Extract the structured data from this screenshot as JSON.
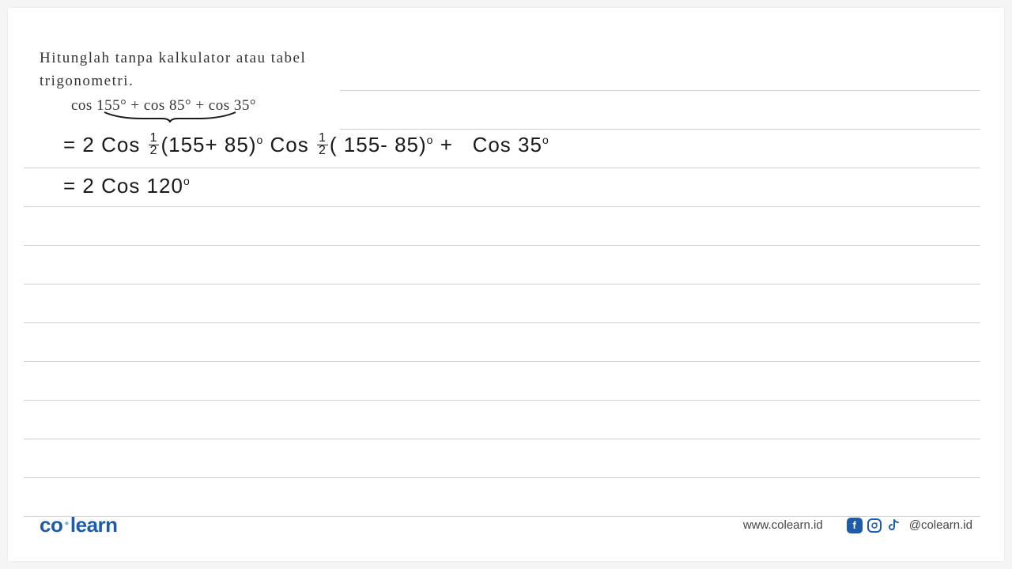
{
  "problem": {
    "line1": "Hitunglah tanpa kalkulator atau tabel",
    "line2": "trigonometri.",
    "formula": "cos 155° + cos 85° + cos 35°"
  },
  "handwriting": {
    "step1_prefix": "= 2 Cos",
    "step1_frac1_num": "1",
    "step1_frac1_den": "2",
    "step1_paren1": "(155+ 85)",
    "step1_mid": " Cos",
    "step1_frac2_num": "1",
    "step1_frac2_den": "2",
    "step1_paren2": "( 155- 85)",
    "step1_plus": " + ",
    "step1_end": "Cos 35",
    "step2": "= 2 Cos 120"
  },
  "footer": {
    "logo_co": "co",
    "logo_learn": "learn",
    "website": "www.colearn.id",
    "handle": "@colearn.id",
    "fb_label": "f",
    "ig_label": "◯",
    "tiktok_label": "♪"
  }
}
